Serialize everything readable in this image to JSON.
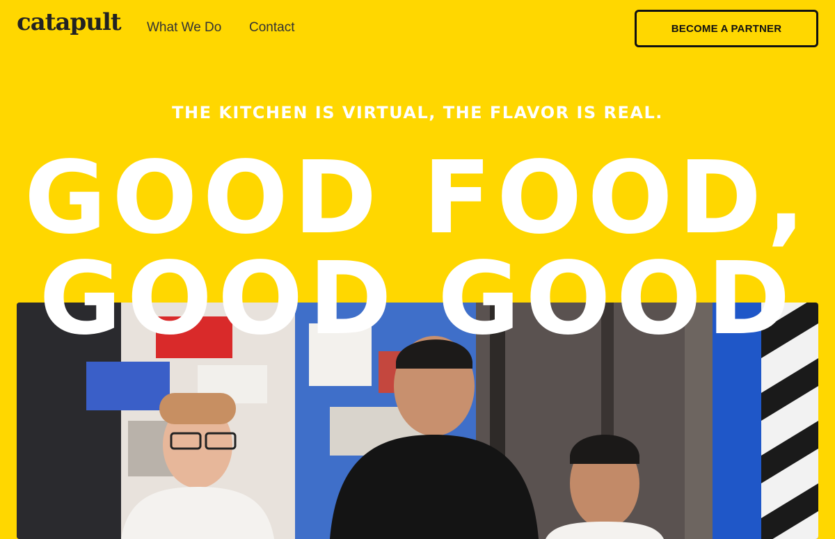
{
  "nav": {
    "logo": "catapult",
    "links": [
      "What We Do",
      "Contact"
    ],
    "cta_label": "BECOME A PARTNER"
  },
  "hero": {
    "tagline": "THE KITCHEN IS VIRTUAL, THE FLAVOR IS REAL.",
    "headline_line1": "GOOD FOOD,",
    "headline_line2": "GOOD GOOD"
  },
  "colors": {
    "background": "#FFD700",
    "headline": "#FFFFFF",
    "text_dark": "#222222"
  },
  "icons": []
}
